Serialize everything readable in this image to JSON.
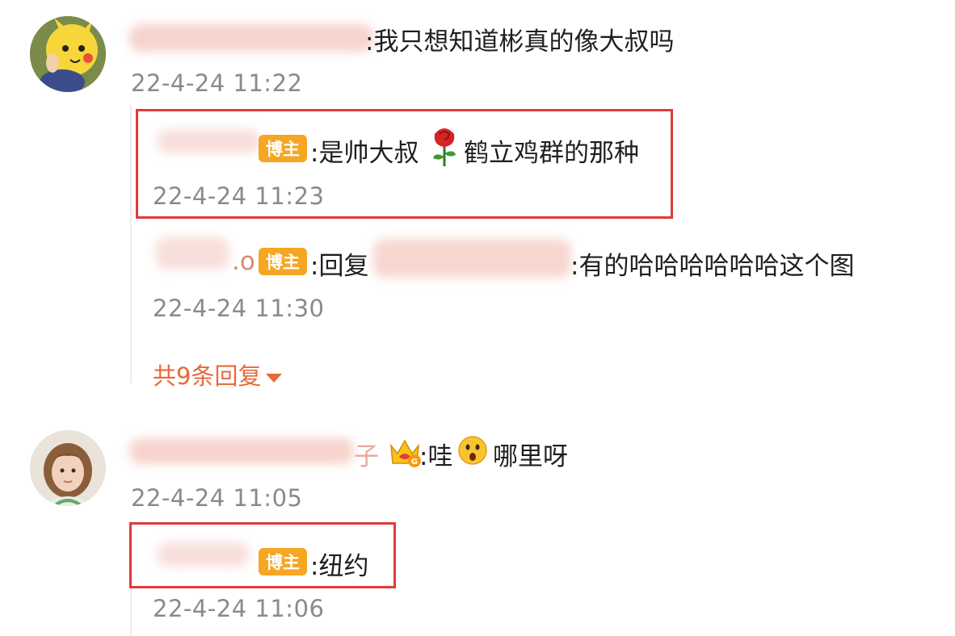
{
  "comments": [
    {
      "text": ":我只想知道彬真的像大叔吗",
      "time": "22-4-24 11:22",
      "replies": [
        {
          "badge": "博主",
          "text": ":是帅大叔",
          "text_after_emoji": "鹤立鸡群的那种",
          "emoji": "rose-icon",
          "time": "22-4-24 11:23",
          "highlighted": true
        },
        {
          "name_fragment": ".o",
          "badge": "博主",
          "text_before": ":回复",
          "text": ":有的哈哈哈哈哈哈这个图",
          "time": "22-4-24 11:30",
          "highlighted": false
        }
      ],
      "more_replies": "共9条回复"
    },
    {
      "name_fragment": "子",
      "text_a": ":哇",
      "text_b": "哪里呀",
      "emoji": "surprised-face-icon",
      "crown_icon": "crown-icon",
      "time": "22-4-24 11:05",
      "replies": [
        {
          "badge": "博主",
          "text": ":纽约",
          "time": "22-4-24 11:06",
          "highlighted": true
        }
      ]
    }
  ],
  "colors": {
    "highlight_border": "#e23a3a",
    "badge_bg": "#f5a623",
    "more_link": "#e8693a",
    "time": "#8a8a8a"
  }
}
